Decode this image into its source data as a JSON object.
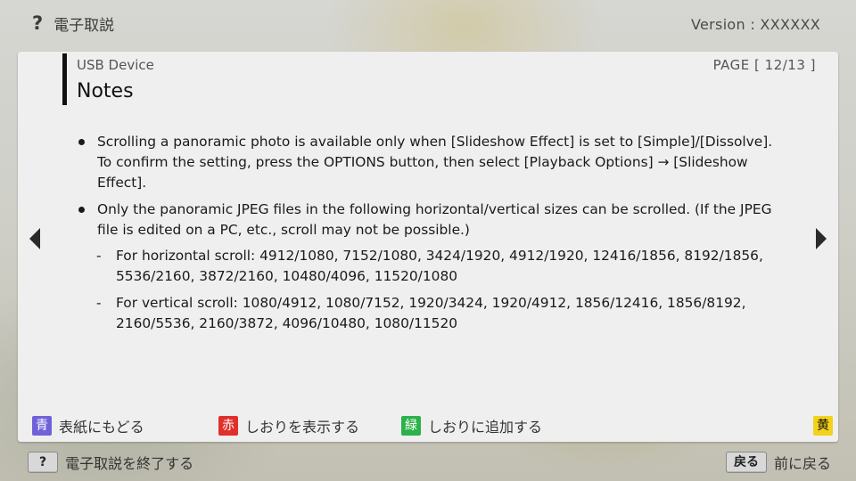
{
  "topbar": {
    "help_icon": "?",
    "title": "電子取説",
    "version": "Version : XXXXXX"
  },
  "panel": {
    "device_label": "USB Device",
    "page_indicator": "PAGE [ 12/13 ]",
    "heading": "Notes",
    "bullets": [
      {
        "text": "Scrolling a panoramic photo is available only when [Slideshow Effect] is set to [Simple]/[Dissolve]. To confirm the setting, press the OPTIONS button, then select [Playback Options] → [Slideshow Effect]."
      },
      {
        "text": "Only the panoramic JPEG files in the following horizontal/vertical sizes can be scrolled. (If the JPEG file is edited on a PC, etc., scroll may not be possible.)",
        "subitems": [
          {
            "dash": "-",
            "text": "For horizontal scroll: 4912/1080, 7152/1080, 3424/1920, 4912/1920, 12416/1856, 8192/1856, 5536/2160, 3872/2160, 10480/4096, 11520/1080"
          },
          {
            "dash": "-",
            "text": "For vertical scroll: 1080/4912, 1080/7152, 1920/3424, 1920/4912, 1856/12416, 1856/8192, 2160/5536, 2160/3872, 4096/10480, 1080/11520"
          }
        ]
      }
    ],
    "nav_left_icon": "arrow-left-icon",
    "nav_right_icon": "arrow-right-icon"
  },
  "legend": {
    "blue": {
      "key": "青",
      "label": "表紙にもどる",
      "color": "#6f62d8"
    },
    "red": {
      "key": "赤",
      "label": "しおりを表示する",
      "color": "#e0302b"
    },
    "green": {
      "key": "緑",
      "label": "しおりに追加する",
      "color": "#2bb24a"
    },
    "yellow": {
      "key": "黄",
      "color": "#f2d21b"
    }
  },
  "bottom": {
    "help_key": "?",
    "help_label": "電子取説を終了する",
    "back_key": "戻る",
    "back_label": "前に戻る"
  }
}
